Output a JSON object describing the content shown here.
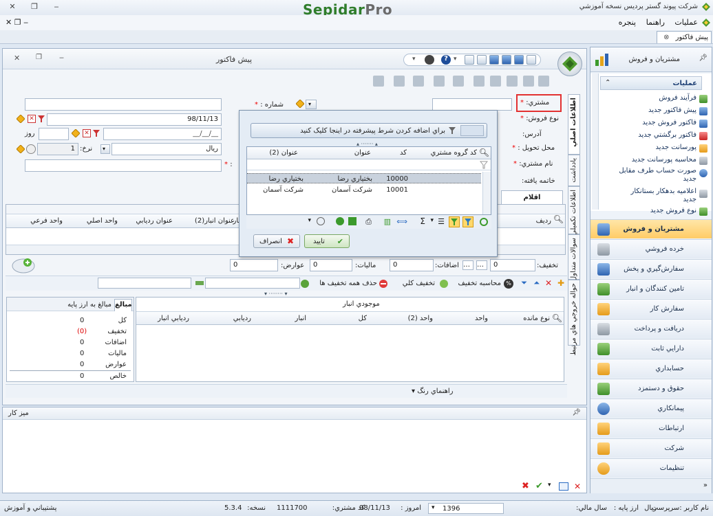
{
  "app": {
    "brand_left": "Sepidar",
    "brand_right": "Pro",
    "title": "شرکت پیوند گستر پردیس نسخه آموزشي"
  },
  "menu": [
    "عمليات",
    "راهنما",
    "پنجره"
  ],
  "doc_tab": "پیش فاکتور",
  "window": {
    "title": "پیش فاکتور"
  },
  "form": {
    "customer_label": "مشتري:",
    "sale_type_label": "نوع فروش:",
    "address_label": "آدرس:",
    "delivery_label": "محل تحويل :",
    "customer_name_label": "نام مشتري:",
    "expiry_label": "خاتمه يافته:",
    "number_label": "شماره :",
    "date_value": "98/11/13",
    "date_placeholder": "__/__/__",
    "days_label": "روز",
    "currency_value": "ريال",
    "rate_label": "نرخ:",
    "rate_value": "1",
    "items_tab": "اقلام",
    "colon": ":"
  },
  "vtabs": [
    "اطلاعات اصلي",
    "يادداشت",
    "اطلاعات تکميلي",
    "سوالات متداول",
    "حواله خروجي هاي مرتبط"
  ],
  "items_grid": {
    "columns": [
      "رديف",
      "عنوان انبار(2)",
      "عنوان رديابي",
      "واحد اصلي",
      "واحد فرعي",
      "انبار"
    ]
  },
  "totals": {
    "discount_label": "تخفيف:",
    "discount_value": "0",
    "additions_label": "اضافات:",
    "additions_value": "0",
    "tax_label": "ماليات:",
    "tax_value": "0",
    "duties_label": "عوارض:",
    "duties_value": "0"
  },
  "discount_bar": {
    "calc": "محاسبه تخفيف",
    "total_discount": "تخفيف کلي",
    "remove_all": "حذف همه تخفيف ها"
  },
  "popup": {
    "hint": "براي اضافه کردن شرط پيشرفته در اينجا کليک کنيد",
    "columns": [
      "کد گروه مشتري",
      "کد",
      "عنوان",
      "عنوان (2)"
    ],
    "rows": [
      {
        "code": "10000",
        "title": "بختياري رضا",
        "title2": "بختياري رضا"
      },
      {
        "code": "10001",
        "title": "شرکت آسمان",
        "title2": "شرکت آسمان"
      }
    ],
    "ok": "تاييد",
    "cancel": "انصراف"
  },
  "balance": {
    "tab1": "مبالغ",
    "tab2": "مبالغ به ارز پايه",
    "rows": [
      {
        "label": "کل",
        "value": "0"
      },
      {
        "label": "تخفيف",
        "value": "(0)"
      },
      {
        "label": "اضافات",
        "value": "0"
      },
      {
        "label": "ماليات",
        "value": "0"
      },
      {
        "label": "عوارض",
        "value": "0"
      },
      {
        "label": "خالص",
        "value": "0"
      }
    ]
  },
  "stock": {
    "title": "موجودي انبار",
    "columns": [
      "نوع مانده",
      "واحد",
      "واحد (2)",
      "کل",
      "انبار",
      "رديابي",
      "رديابي انبار"
    ]
  },
  "color_guide": "راهنماي رنگ",
  "desk": {
    "title": "ميز کار"
  },
  "nav": {
    "header": "مشتريان و فروش",
    "ops_title": "عمليات",
    "ops": [
      "فرآيند فروش",
      "پيش فاکتور جديد",
      "فاکتور فروش جديد",
      "فاکتور برگشتي جديد",
      "پورسانت جديد",
      "محاسبه پورسانت جديد",
      "صورت حساب طرف مقابل",
      "جديد",
      "اعلاميه بدهکار بستانکار",
      "جديد",
      "نوع فروش جديد"
    ],
    "categories": [
      "مشتريان و فروش",
      "خرده فروشي",
      "سفارش‌گيري و پخش",
      "تامين کنندگان و انبار",
      "سفارش کار",
      "دريافت و پرداخت",
      "دارايي ثابت",
      "حسابداري",
      "حقوق و دستمزد",
      "پيمانکاري",
      "ارتباطات",
      "شرکت",
      "تنظيمات"
    ]
  },
  "status": {
    "user": "نام کاربر :سرپرست",
    "base_currency_label": "ارز پايه :",
    "base_currency": "ريال",
    "fiscal_year_label": "سال مالي:",
    "fiscal_year": "1396",
    "today_label": "امروز :",
    "today": "98/11/13",
    "customer_code_label": "کد مشتري:",
    "customer_code": "1111700",
    "version_label": "نسخه:",
    "version": "5.3.4",
    "support": "پشتيباني و آموزش"
  }
}
